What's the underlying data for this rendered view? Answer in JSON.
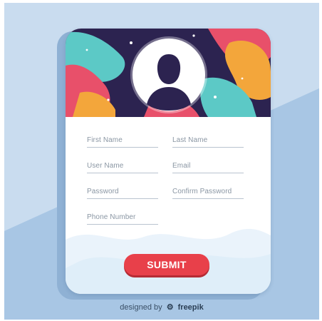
{
  "form": {
    "first_name_placeholder": "First Name",
    "last_name_placeholder": "Last Name",
    "user_name_placeholder": "User Name",
    "email_placeholder": "Email",
    "password_placeholder": "Password",
    "confirm_password_placeholder": "Confirm Password",
    "phone_placeholder": "Phone Number",
    "submit_label": "SUBMIT"
  },
  "footer": {
    "credit_prefix": "designed by",
    "brand_name": "freepik"
  },
  "colors": {
    "background": "#a8c6e4",
    "header_dark": "#2c2350",
    "accent_red": "#e8404a",
    "accent_orange": "#f3a63b",
    "accent_teal": "#5cc9c6",
    "accent_pink": "#e8506a",
    "avatar_silhouette": "#2c2350"
  },
  "icons": {
    "avatar": "user-silhouette-icon",
    "brand_logo": "freepik-logo-icon"
  }
}
